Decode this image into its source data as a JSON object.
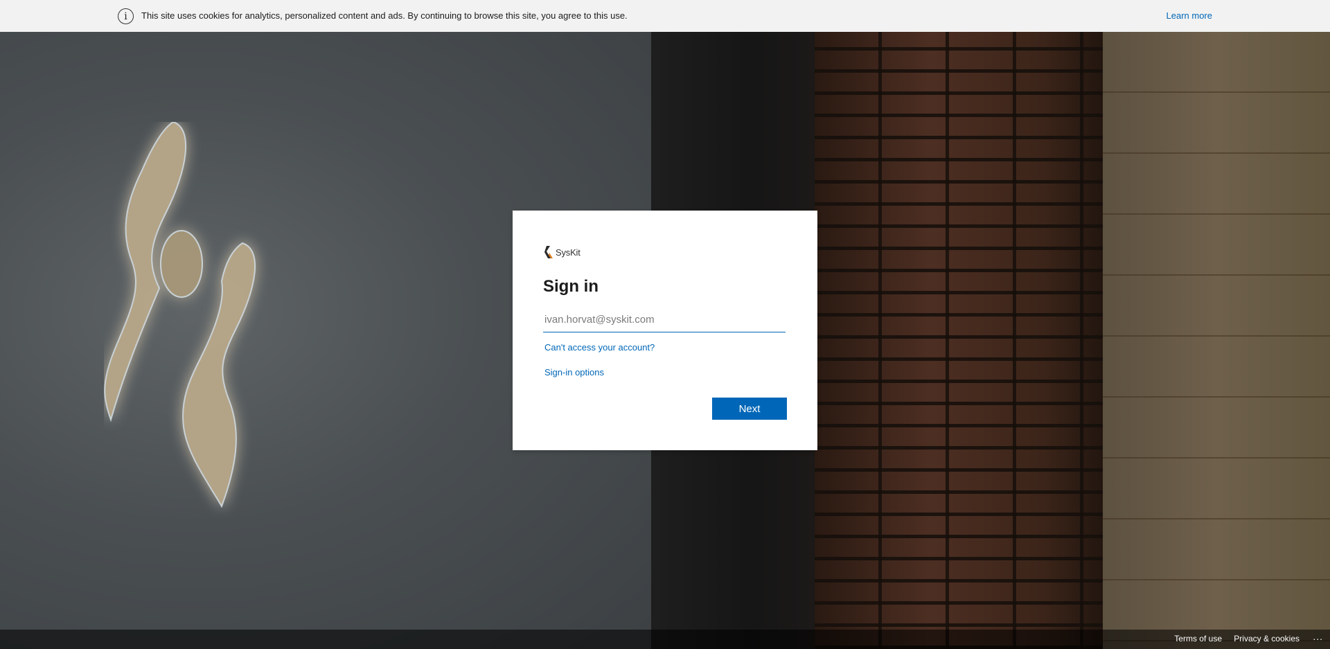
{
  "cookie_banner": {
    "icon": "info-icon",
    "text": "This site uses cookies for analytics, personalized content and ads. By continuing to browse this site, you agree to this use.",
    "learn_more": "Learn more"
  },
  "signin": {
    "logo_text": "SysKit",
    "title": "Sign in",
    "email_placeholder": "ivan.horvat@syskit.com",
    "cant_access": "Can't access your account?",
    "signin_options": "Sign-in options",
    "next_label": "Next"
  },
  "footer": {
    "terms": "Terms of use",
    "privacy": "Privacy & cookies",
    "more": "..."
  },
  "colors": {
    "accent": "#0067b8",
    "banner_bg": "#f2f2f2"
  }
}
